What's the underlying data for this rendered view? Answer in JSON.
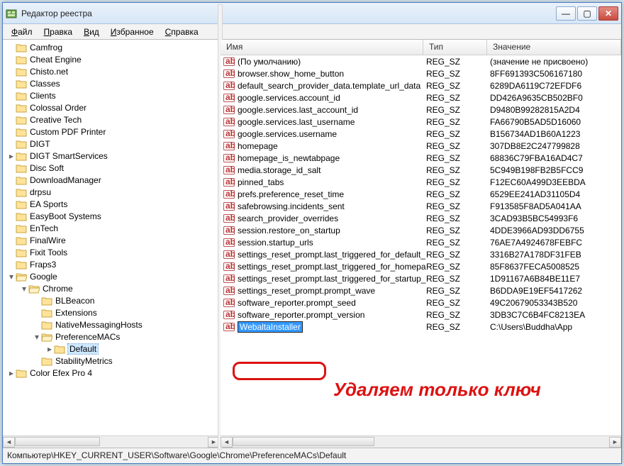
{
  "title": "Редактор реестра",
  "menu": [
    "Файл",
    "Правка",
    "Вид",
    "Избранное",
    "Справка"
  ],
  "columns": {
    "name": "Имя",
    "type": "Тип",
    "value": "Значение"
  },
  "tree": [
    {
      "d": 1,
      "e": "",
      "l": "Camfrog"
    },
    {
      "d": 1,
      "e": "",
      "l": "Cheat Engine"
    },
    {
      "d": 1,
      "e": "",
      "l": "Chisto.net"
    },
    {
      "d": 1,
      "e": "",
      "l": "Classes"
    },
    {
      "d": 1,
      "e": "",
      "l": "Clients"
    },
    {
      "d": 1,
      "e": "",
      "l": "Colossal Order"
    },
    {
      "d": 1,
      "e": "",
      "l": "Creative Tech"
    },
    {
      "d": 1,
      "e": "",
      "l": "Custom PDF Printer"
    },
    {
      "d": 1,
      "e": "",
      "l": "DIGT"
    },
    {
      "d": 1,
      "e": "▸",
      "l": "DIGT SmartServices"
    },
    {
      "d": 1,
      "e": "",
      "l": "Disc Soft"
    },
    {
      "d": 1,
      "e": "",
      "l": "DownloadManager"
    },
    {
      "d": 1,
      "e": "",
      "l": "drpsu"
    },
    {
      "d": 1,
      "e": "",
      "l": "EA Sports"
    },
    {
      "d": 1,
      "e": "",
      "l": "EasyBoot Systems"
    },
    {
      "d": 1,
      "e": "",
      "l": "EnTech"
    },
    {
      "d": 1,
      "e": "",
      "l": "FinalWire"
    },
    {
      "d": 1,
      "e": "",
      "l": "Fixit Tools"
    },
    {
      "d": 1,
      "e": "",
      "l": "Fraps3"
    },
    {
      "d": 1,
      "e": "▾",
      "l": "Google"
    },
    {
      "d": 2,
      "e": "▾",
      "l": "Chrome"
    },
    {
      "d": 3,
      "e": "",
      "l": "BLBeacon"
    },
    {
      "d": 3,
      "e": "",
      "l": "Extensions"
    },
    {
      "d": 3,
      "e": "",
      "l": "NativeMessagingHosts"
    },
    {
      "d": 3,
      "e": "▾",
      "l": "PreferenceMACs"
    },
    {
      "d": 4,
      "e": "▸",
      "l": "Default",
      "sel": true
    },
    {
      "d": 3,
      "e": "",
      "l": "StabilityMetrics"
    },
    {
      "d": 1,
      "e": "▸",
      "l": "Color Efex Pro 4"
    }
  ],
  "rows": [
    {
      "n": "(По умолчанию)",
      "t": "REG_SZ",
      "v": "(значение не присвоено)"
    },
    {
      "n": "browser.show_home_button",
      "t": "REG_SZ",
      "v": "8FF691393C506167180"
    },
    {
      "n": "default_search_provider_data.template_url_data",
      "t": "REG_SZ",
      "v": "6289DA6119C72EFDF6"
    },
    {
      "n": "google.services.account_id",
      "t": "REG_SZ",
      "v": "DD426A9635CB502BF0"
    },
    {
      "n": "google.services.last_account_id",
      "t": "REG_SZ",
      "v": "D9480B99282815A2D4"
    },
    {
      "n": "google.services.last_username",
      "t": "REG_SZ",
      "v": "FA66790B5AD5D16060"
    },
    {
      "n": "google.services.username",
      "t": "REG_SZ",
      "v": "B156734AD1B60A1223"
    },
    {
      "n": "homepage",
      "t": "REG_SZ",
      "v": "307DB8E2C247799828"
    },
    {
      "n": "homepage_is_newtabpage",
      "t": "REG_SZ",
      "v": "68836C79FBA16AD4C7"
    },
    {
      "n": "media.storage_id_salt",
      "t": "REG_SZ",
      "v": "5C949B198FB2B5FCC9"
    },
    {
      "n": "pinned_tabs",
      "t": "REG_SZ",
      "v": "F12EC60A499D3EEBDA"
    },
    {
      "n": "prefs.preference_reset_time",
      "t": "REG_SZ",
      "v": "6529EE241AD31105D4"
    },
    {
      "n": "safebrowsing.incidents_sent",
      "t": "REG_SZ",
      "v": "F913585F8AD5A041AA"
    },
    {
      "n": "search_provider_overrides",
      "t": "REG_SZ",
      "v": "3CAD93B5BC54993F6"
    },
    {
      "n": "session.restore_on_startup",
      "t": "REG_SZ",
      "v": "4DDE3966AD93DD6755"
    },
    {
      "n": "session.startup_urls",
      "t": "REG_SZ",
      "v": "76AE7A4924678FEBFC"
    },
    {
      "n": "settings_reset_prompt.last_triggered_for_default_…",
      "t": "REG_SZ",
      "v": "3316B27A178DF31FEB"
    },
    {
      "n": "settings_reset_prompt.last_triggered_for_homepa…",
      "t": "REG_SZ",
      "v": "85F8637FECA5008525"
    },
    {
      "n": "settings_reset_prompt.last_triggered_for_startup_…",
      "t": "REG_SZ",
      "v": "1D91167A6B84BE11E7"
    },
    {
      "n": "settings_reset_prompt.prompt_wave",
      "t": "REG_SZ",
      "v": "B6DDA9E19EF5417262"
    },
    {
      "n": "software_reporter.prompt_seed",
      "t": "REG_SZ",
      "v": "49C20679053343B520"
    },
    {
      "n": "software_reporter.prompt_version",
      "t": "REG_SZ",
      "v": "3DB3C7C6B4FC8213EA"
    },
    {
      "n": "WebaltaInstaller",
      "t": "REG_SZ",
      "v": "C:\\Users\\Buddha\\App",
      "edit": true
    }
  ],
  "statusbar": "Компьютер\\HKEY_CURRENT_USER\\Software\\Google\\Chrome\\PreferenceMACs\\Default",
  "callout_text": "Удаляем только ключ",
  "winbtn": {
    "min": "—",
    "max": "▢",
    "close": "✕"
  }
}
